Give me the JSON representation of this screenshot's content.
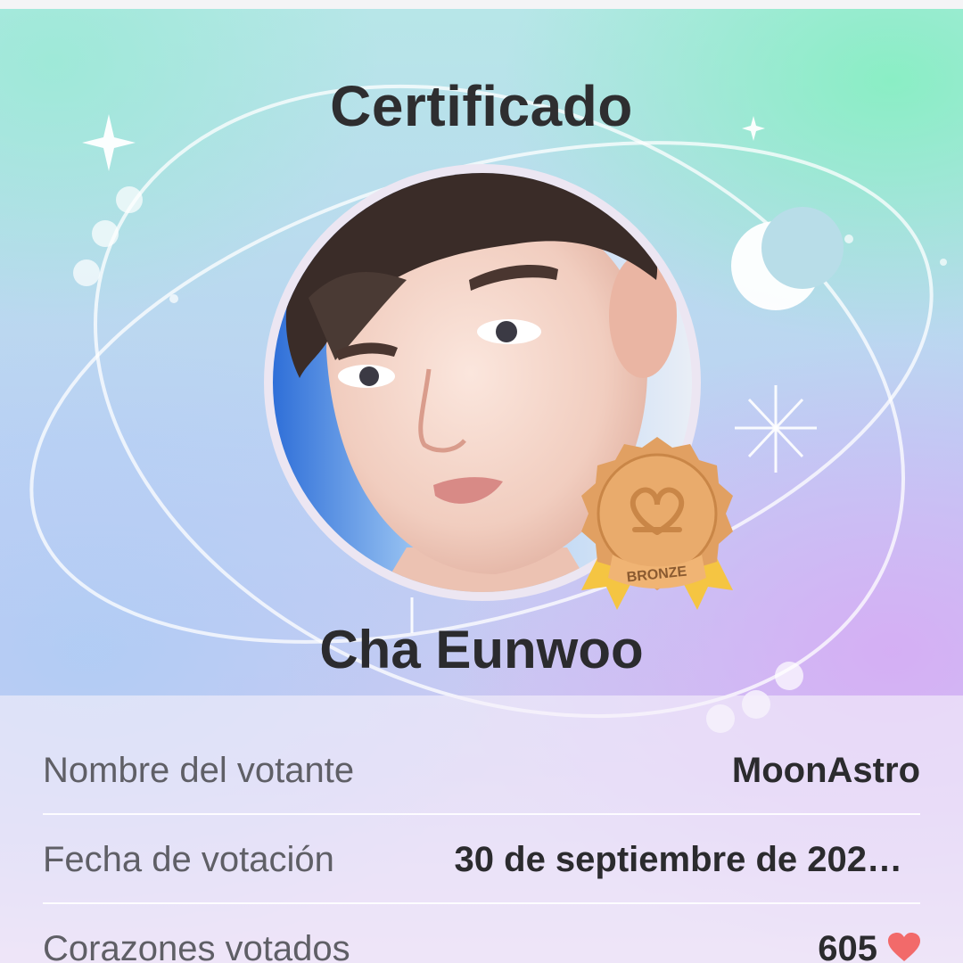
{
  "certificate": {
    "title": "Certificado",
    "artist_name": "Cha Eunwoo",
    "badge": {
      "level": "BRONZE",
      "icon": "heart-loop-icon",
      "color": "#d89858"
    },
    "avatar": {
      "description_icon": "artist-photo"
    }
  },
  "info": {
    "voter_label": "Nombre del votante",
    "voter_value": "MoonAstro",
    "date_label": "Fecha de votación",
    "date_value": "30 de septiembre de 202…",
    "hearts_label": "Corazones votados",
    "hearts_value": "605",
    "heart_icon": "heart-icon",
    "heart_color": "#f26a6a"
  },
  "colors": {
    "text_dark": "#2e2e30",
    "text_label": "#5f5f66"
  }
}
